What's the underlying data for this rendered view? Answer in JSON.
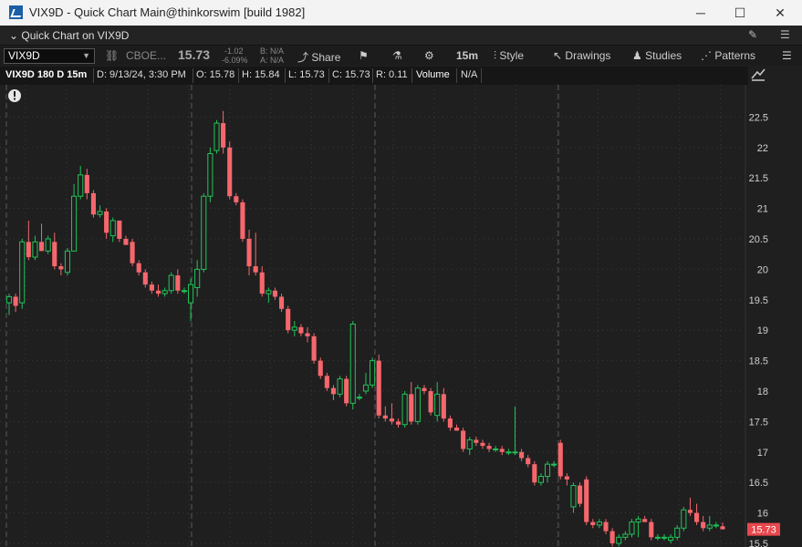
{
  "window": {
    "title": "VIX9D - Quick Chart Main@thinkorswim [build 1982]",
    "minimize": "─",
    "maximize": "☐",
    "close": "✕"
  },
  "quickbar": {
    "label": "Quick Chart on VIX9D"
  },
  "toolbar": {
    "symbol": "VIX9D",
    "exchange": "CBOE...",
    "last": "15.73",
    "change": "-1.02",
    "change_pct": "-6.09%",
    "bid": "B: N/A",
    "ask": "A: N/A",
    "share": "Share",
    "timeframe": "15m",
    "style": "Style",
    "drawings": "Drawings",
    "studies": "Studies",
    "patterns": "Patterns"
  },
  "info": {
    "period": "VIX9D 180 D 15m",
    "date": "D: 9/13/24, 3:30 PM",
    "open": "O: 15.78",
    "high": "H: 15.84",
    "low": "L: 15.73",
    "close": "C: 15.73",
    "range": "R: 0.11",
    "volume": "Volume",
    "volume_value": "N/A"
  },
  "colors": {
    "up": "#21c45a",
    "down": "#f5676d",
    "background": "#1f1f1f",
    "price_tag": "#e8484e"
  },
  "chart_data": {
    "type": "candlestick",
    "symbol": "VIX9D",
    "interval": "15m",
    "last_price": 15.73,
    "yticks": [
      22.5,
      22,
      21.5,
      21,
      20.5,
      20,
      19.5,
      19,
      18.5,
      18,
      17.5,
      17,
      16.5,
      16,
      15.5
    ],
    "ylim": [
      15.44,
      23.03
    ],
    "grid": true,
    "candles": [
      {
        "o": 19.45,
        "h": 19.6,
        "l": 19.25,
        "c": 19.55
      },
      {
        "o": 19.55,
        "h": 19.6,
        "l": 19.3,
        "c": 19.4
      },
      {
        "o": 19.45,
        "h": 20.5,
        "l": 19.35,
        "c": 20.45
      },
      {
        "o": 20.45,
        "h": 20.8,
        "l": 20.15,
        "c": 20.2
      },
      {
        "o": 20.2,
        "h": 20.55,
        "l": 20.15,
        "c": 20.45
      },
      {
        "o": 20.45,
        "h": 20.75,
        "l": 20.3,
        "c": 20.3
      },
      {
        "o": 20.3,
        "h": 20.55,
        "l": 20.25,
        "c": 20.5
      },
      {
        "o": 20.45,
        "h": 20.6,
        "l": 20.0,
        "c": 20.05
      },
      {
        "o": 20.05,
        "h": 20.1,
        "l": 19.9,
        "c": 20.0
      },
      {
        "o": 19.95,
        "h": 20.35,
        "l": 19.9,
        "c": 20.3
      },
      {
        "o": 20.3,
        "h": 21.4,
        "l": 20.3,
        "c": 21.2
      },
      {
        "o": 21.2,
        "h": 21.7,
        "l": 21.15,
        "c": 21.55
      },
      {
        "o": 21.55,
        "h": 21.65,
        "l": 21.15,
        "c": 21.25
      },
      {
        "o": 21.25,
        "h": 21.3,
        "l": 20.85,
        "c": 20.9
      },
      {
        "o": 20.9,
        "h": 21.05,
        "l": 20.85,
        "c": 20.95
      },
      {
        "o": 20.95,
        "h": 21.0,
        "l": 20.5,
        "c": 20.6
      },
      {
        "o": 20.55,
        "h": 20.85,
        "l": 20.45,
        "c": 20.8
      },
      {
        "o": 20.8,
        "h": 20.8,
        "l": 20.45,
        "c": 20.5
      },
      {
        "o": 20.5,
        "h": 20.55,
        "l": 20.4,
        "c": 20.4
      },
      {
        "o": 20.45,
        "h": 20.5,
        "l": 20.05,
        "c": 20.1
      },
      {
        "o": 20.1,
        "h": 20.15,
        "l": 19.9,
        "c": 19.95
      },
      {
        "o": 19.95,
        "h": 20.0,
        "l": 19.7,
        "c": 19.75
      },
      {
        "o": 19.75,
        "h": 19.8,
        "l": 19.6,
        "c": 19.65
      },
      {
        "o": 19.65,
        "h": 19.75,
        "l": 19.55,
        "c": 19.6
      },
      {
        "o": 19.6,
        "h": 19.7,
        "l": 19.55,
        "c": 19.65
      },
      {
        "o": 19.65,
        "h": 19.95,
        "l": 19.6,
        "c": 19.9
      },
      {
        "o": 19.9,
        "h": 20.0,
        "l": 19.6,
        "c": 19.65
      },
      {
        "o": 19.65,
        "h": 19.7,
        "l": 19.6,
        "c": 19.65
      },
      {
        "o": 19.45,
        "h": 19.85,
        "l": 19.15,
        "c": 19.75
      },
      {
        "o": 19.7,
        "h": 20.15,
        "l": 19.55,
        "c": 20.0
      },
      {
        "o": 20.0,
        "h": 21.25,
        "l": 19.95,
        "c": 21.2
      },
      {
        "o": 21.2,
        "h": 22.0,
        "l": 21.1,
        "c": 21.9
      },
      {
        "o": 21.95,
        "h": 22.45,
        "l": 21.9,
        "c": 22.4
      },
      {
        "o": 22.4,
        "h": 22.6,
        "l": 21.9,
        "c": 22.0
      },
      {
        "o": 22.0,
        "h": 22.1,
        "l": 21.15,
        "c": 21.2
      },
      {
        "o": 21.2,
        "h": 21.25,
        "l": 21.05,
        "c": 21.1
      },
      {
        "o": 21.1,
        "h": 21.15,
        "l": 20.45,
        "c": 20.5
      },
      {
        "o": 20.5,
        "h": 20.65,
        "l": 19.9,
        "c": 20.05
      },
      {
        "o": 20.05,
        "h": 20.6,
        "l": 19.9,
        "c": 19.95
      },
      {
        "o": 19.95,
        "h": 20.05,
        "l": 19.55,
        "c": 19.6
      },
      {
        "o": 19.6,
        "h": 19.7,
        "l": 19.45,
        "c": 19.65
      },
      {
        "o": 19.65,
        "h": 19.7,
        "l": 19.5,
        "c": 19.55
      },
      {
        "o": 19.55,
        "h": 19.6,
        "l": 19.3,
        "c": 19.35
      },
      {
        "o": 19.35,
        "h": 19.4,
        "l": 18.95,
        "c": 19.0
      },
      {
        "o": 19.0,
        "h": 19.15,
        "l": 18.9,
        "c": 19.05
      },
      {
        "o": 19.05,
        "h": 19.1,
        "l": 18.9,
        "c": 18.95
      },
      {
        "o": 18.95,
        "h": 19.05,
        "l": 18.8,
        "c": 18.9
      },
      {
        "o": 18.9,
        "h": 18.95,
        "l": 18.45,
        "c": 18.5
      },
      {
        "o": 18.5,
        "h": 18.55,
        "l": 18.2,
        "c": 18.25
      },
      {
        "o": 18.25,
        "h": 18.3,
        "l": 18.0,
        "c": 18.05
      },
      {
        "o": 18.05,
        "h": 18.1,
        "l": 17.85,
        "c": 17.95
      },
      {
        "o": 17.95,
        "h": 18.25,
        "l": 17.9,
        "c": 18.2
      },
      {
        "o": 18.2,
        "h": 18.25,
        "l": 17.75,
        "c": 17.8
      },
      {
        "o": 17.8,
        "h": 19.15,
        "l": 17.7,
        "c": 19.1
      },
      {
        "o": 17.9,
        "h": 17.95,
        "l": 17.85,
        "c": 17.9
      },
      {
        "o": 18.0,
        "h": 18.3,
        "l": 17.95,
        "c": 18.1
      },
      {
        "o": 18.1,
        "h": 18.55,
        "l": 18.05,
        "c": 18.5
      },
      {
        "o": 18.5,
        "h": 18.6,
        "l": 17.55,
        "c": 17.6
      },
      {
        "o": 17.6,
        "h": 17.75,
        "l": 17.5,
        "c": 17.55
      },
      {
        "o": 17.55,
        "h": 17.8,
        "l": 17.45,
        "c": 17.5
      },
      {
        "o": 17.5,
        "h": 17.55,
        "l": 17.4,
        "c": 17.45
      },
      {
        "o": 17.45,
        "h": 18.0,
        "l": 17.4,
        "c": 17.95
      },
      {
        "o": 17.95,
        "h": 18.15,
        "l": 17.45,
        "c": 17.5
      },
      {
        "o": 17.5,
        "h": 18.1,
        "l": 17.45,
        "c": 18.05
      },
      {
        "o": 18.05,
        "h": 18.1,
        "l": 17.95,
        "c": 18.0
      },
      {
        "o": 18.0,
        "h": 18.05,
        "l": 17.6,
        "c": 17.65
      },
      {
        "o": 17.6,
        "h": 18.15,
        "l": 17.5,
        "c": 17.95
      },
      {
        "o": 17.95,
        "h": 18.05,
        "l": 17.5,
        "c": 17.55
      },
      {
        "o": 17.55,
        "h": 17.6,
        "l": 17.35,
        "c": 17.4
      },
      {
        "o": 17.4,
        "h": 17.45,
        "l": 17.35,
        "c": 17.35
      },
      {
        "o": 17.35,
        "h": 17.4,
        "l": 17.0,
        "c": 17.05
      },
      {
        "o": 17.05,
        "h": 17.25,
        "l": 16.95,
        "c": 17.2
      },
      {
        "o": 17.2,
        "h": 17.25,
        "l": 17.1,
        "c": 17.15
      },
      {
        "o": 17.15,
        "h": 17.2,
        "l": 17.05,
        "c": 17.1
      },
      {
        "o": 17.1,
        "h": 17.15,
        "l": 17.0,
        "c": 17.05
      },
      {
        "o": 17.05,
        "h": 17.1,
        "l": 17.0,
        "c": 17.05
      },
      {
        "o": 17.05,
        "h": 17.1,
        "l": 16.95,
        "c": 17.0
      },
      {
        "o": 17.0,
        "h": 17.05,
        "l": 16.95,
        "c": 17.0
      },
      {
        "o": 17.0,
        "h": 17.75,
        "l": 16.95,
        "c": 17.0
      },
      {
        "o": 17.0,
        "h": 17.05,
        "l": 16.85,
        "c": 16.9
      },
      {
        "o": 16.9,
        "h": 16.95,
        "l": 16.75,
        "c": 16.8
      },
      {
        "o": 16.8,
        "h": 16.85,
        "l": 16.45,
        "c": 16.5
      },
      {
        "o": 16.5,
        "h": 16.65,
        "l": 16.45,
        "c": 16.6
      },
      {
        "o": 16.6,
        "h": 16.85,
        "l": 16.5,
        "c": 16.8
      },
      {
        "o": 16.8,
        "h": 16.85,
        "l": 16.75,
        "c": 16.8
      },
      {
        "o": 17.15,
        "h": 17.2,
        "l": 16.55,
        "c": 16.6
      },
      {
        "o": 16.6,
        "h": 16.65,
        "l": 16.45,
        "c": 16.55
      },
      {
        "o": 16.1,
        "h": 16.5,
        "l": 16.0,
        "c": 16.45
      },
      {
        "o": 16.45,
        "h": 16.5,
        "l": 16.1,
        "c": 16.15
      },
      {
        "o": 16.55,
        "h": 16.6,
        "l": 15.8,
        "c": 15.85
      },
      {
        "o": 15.85,
        "h": 15.9,
        "l": 15.75,
        "c": 15.8
      },
      {
        "o": 15.8,
        "h": 15.9,
        "l": 15.75,
        "c": 15.85
      },
      {
        "o": 15.85,
        "h": 15.9,
        "l": 15.65,
        "c": 15.7
      },
      {
        "o": 15.7,
        "h": 15.75,
        "l": 15.45,
        "c": 15.5
      },
      {
        "o": 15.5,
        "h": 15.65,
        "l": 15.45,
        "c": 15.6
      },
      {
        "o": 15.6,
        "h": 15.7,
        "l": 15.55,
        "c": 15.65
      },
      {
        "o": 15.65,
        "h": 15.9,
        "l": 15.6,
        "c": 15.85
      },
      {
        "o": 15.85,
        "h": 15.95,
        "l": 15.6,
        "c": 15.9
      },
      {
        "o": 15.9,
        "h": 15.95,
        "l": 15.85,
        "c": 15.85
      },
      {
        "o": 15.85,
        "h": 15.9,
        "l": 15.55,
        "c": 15.6
      },
      {
        "o": 15.6,
        "h": 15.65,
        "l": 15.55,
        "c": 15.6
      },
      {
        "o": 15.6,
        "h": 15.65,
        "l": 15.55,
        "c": 15.6
      },
      {
        "o": 15.55,
        "h": 15.65,
        "l": 15.5,
        "c": 15.6
      },
      {
        "o": 15.6,
        "h": 15.8,
        "l": 15.55,
        "c": 15.75
      },
      {
        "o": 15.75,
        "h": 16.1,
        "l": 15.7,
        "c": 16.05
      },
      {
        "o": 16.05,
        "h": 16.25,
        "l": 15.95,
        "c": 16.0
      },
      {
        "o": 16.0,
        "h": 16.15,
        "l": 15.8,
        "c": 15.85
      },
      {
        "o": 15.85,
        "h": 15.95,
        "l": 15.7,
        "c": 15.75
      },
      {
        "o": 15.75,
        "h": 15.95,
        "l": 15.7,
        "c": 15.8
      },
      {
        "o": 15.8,
        "h": 15.85,
        "l": 15.75,
        "c": 15.8
      },
      {
        "o": 15.78,
        "h": 15.84,
        "l": 15.73,
        "c": 15.73
      }
    ]
  }
}
